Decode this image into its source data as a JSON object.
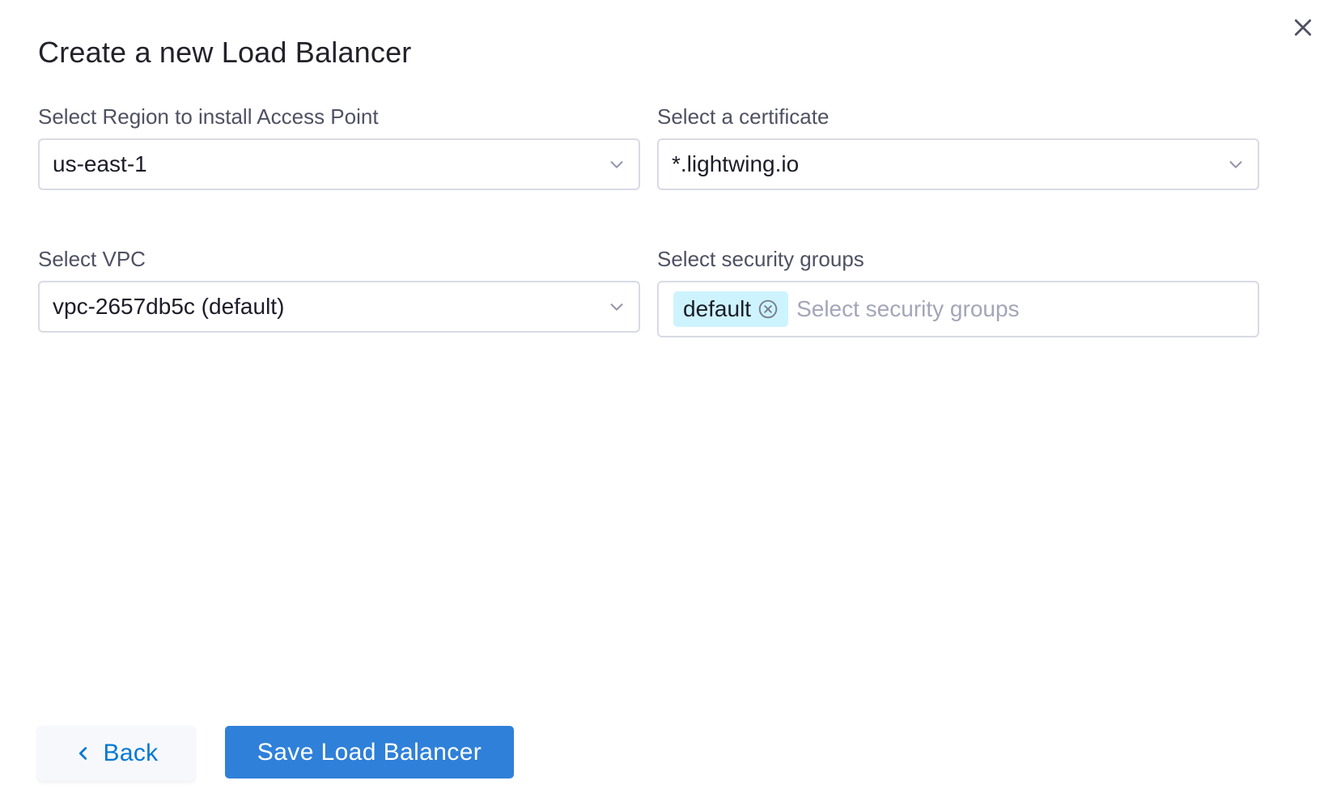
{
  "dialog": {
    "title": "Create a new Load Balancer"
  },
  "form": {
    "region": {
      "label": "Select Region to install Access Point",
      "value": "us-east-1"
    },
    "certificate": {
      "label": "Select a certificate",
      "value": "*.lightwing.io"
    },
    "vpc": {
      "label": "Select VPC",
      "value": "vpc-2657db5c (default)"
    },
    "security_groups": {
      "label": "Select security groups",
      "selected": [
        "default"
      ],
      "placeholder": "Select security groups"
    }
  },
  "footer": {
    "back_label": "Back",
    "save_label": "Save Load Balancer"
  },
  "colors": {
    "primary": "#2f80d9",
    "link": "#0278d5",
    "tag_bg": "#cdf4fe",
    "border": "#d9dae5"
  },
  "icons": {
    "close": "close-icon",
    "chevron": "chevron-down-icon",
    "tag_remove": "remove-circle-icon",
    "back": "chevron-left-icon"
  }
}
